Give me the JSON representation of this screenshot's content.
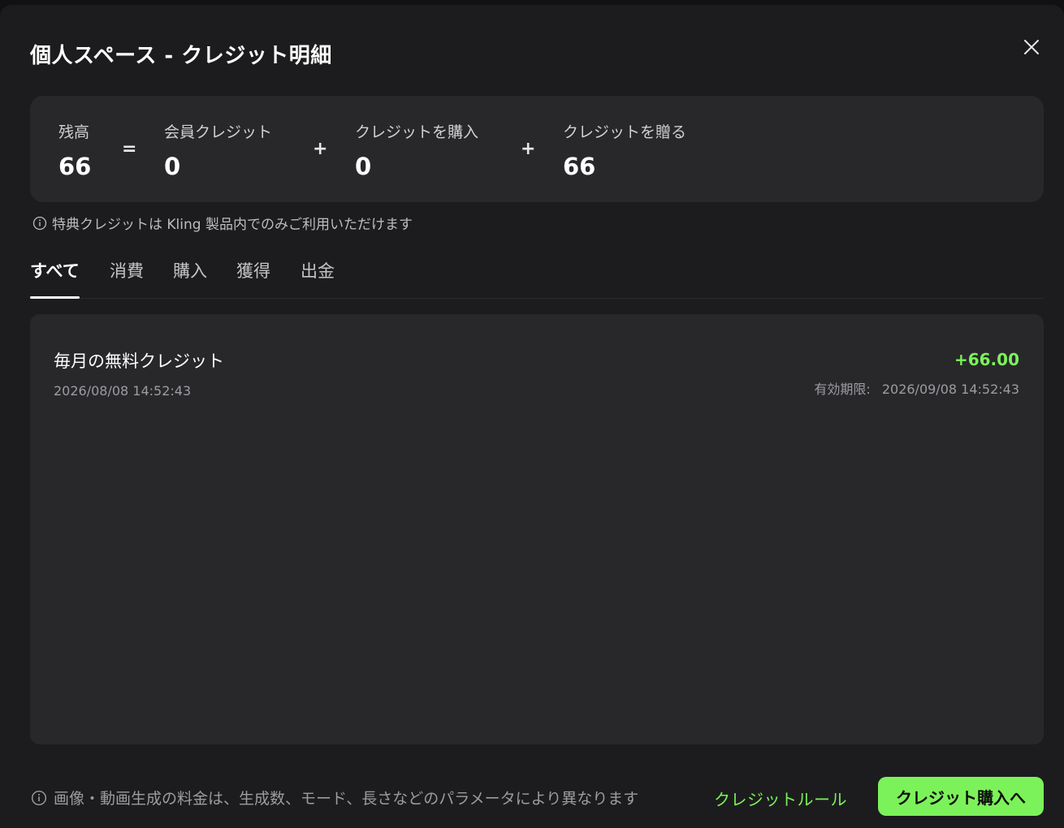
{
  "modal": {
    "title": "個人スペース - クレジット明細",
    "close_icon": "close-icon"
  },
  "balance": {
    "total": {
      "label": "残高",
      "value": "66"
    },
    "eq_sign": "=",
    "plus_sign": "+",
    "member": {
      "label": "会員クレジット",
      "value": "0"
    },
    "purchased": {
      "label": "クレジットを購入",
      "value": "0"
    },
    "gifted": {
      "label": "クレジットを贈る",
      "value": "66"
    }
  },
  "notice": {
    "icon": "info-icon",
    "text": "特典クレジットは Kling 製品内でのみご利用いただけます"
  },
  "tabs": [
    {
      "label": "すべて",
      "active": true
    },
    {
      "label": "消費",
      "active": false
    },
    {
      "label": "購入",
      "active": false
    },
    {
      "label": "獲得",
      "active": false
    },
    {
      "label": "出金",
      "active": false
    }
  ],
  "records": [
    {
      "title": "毎月の無料クレジット",
      "time": "2026/08/08 14:52:43",
      "amount": "+66.00",
      "expiry_label": "有効期限:",
      "expiry_time": "2026/09/08 14:52:43"
    }
  ],
  "footer": {
    "note": "画像・動画生成の料金は、生成数、モード、長さなどのパラメータにより異なります",
    "rules_link": "クレジットルール",
    "buy_button": "クレジット購入へ"
  },
  "colors": {
    "accent": "#7cf25a",
    "panel": "#28282b",
    "background": "#1c1c1e"
  }
}
